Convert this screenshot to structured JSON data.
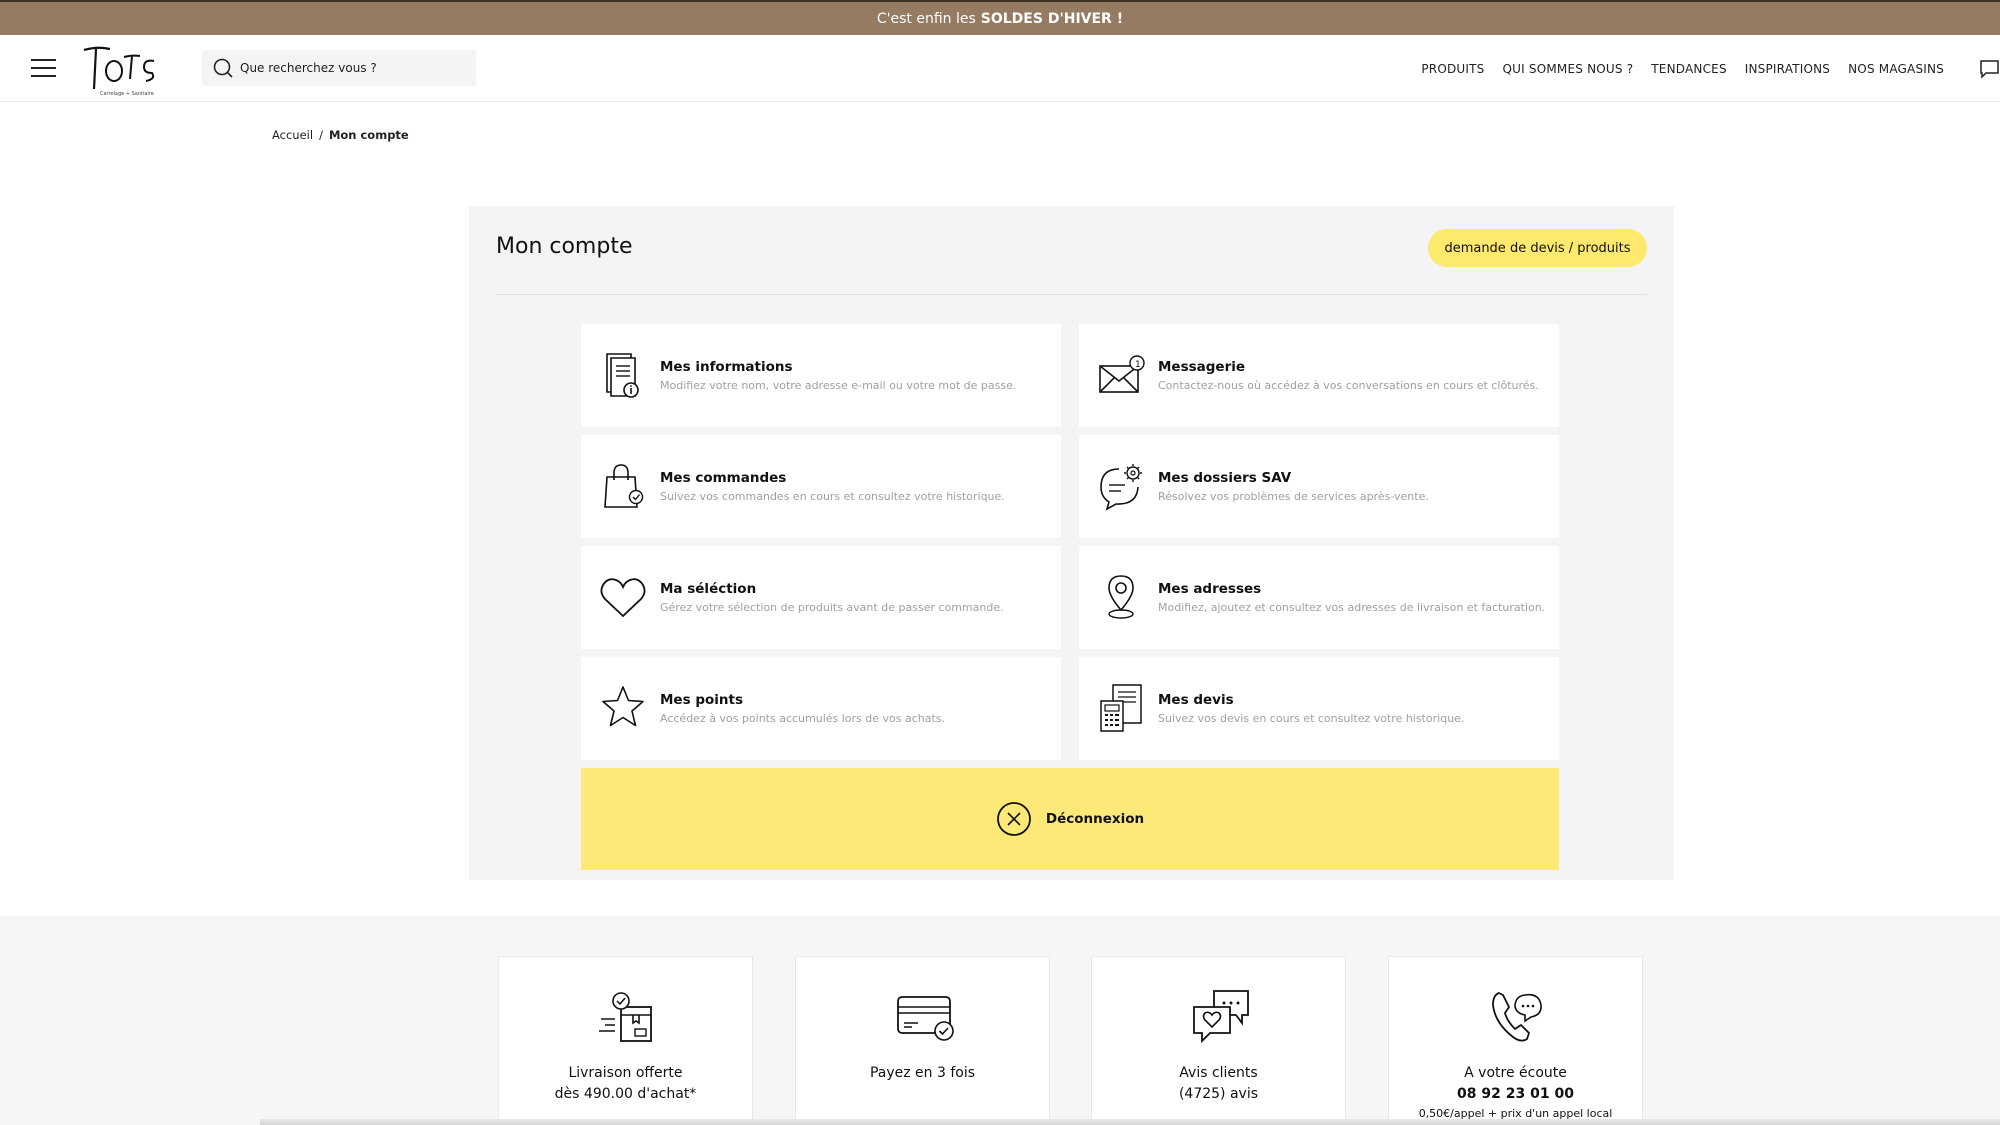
{
  "promo": {
    "prefix": "C'est enfin les",
    "highlight": "SOLDES D'HIVER !"
  },
  "header": {
    "logo_text": "Tots",
    "logo_tagline": "Carrelage + Sanitaire",
    "search_placeholder": "Que recherchez vous ?",
    "nav": [
      "PRODUITS",
      "QUI SOMMES NOUS ?",
      "TENDANCES",
      "INSPIRATIONS",
      "NOS MAGASINS"
    ]
  },
  "breadcrumb": {
    "home": "Accueil",
    "separator": "/",
    "current": "Mon compte"
  },
  "account": {
    "title": "Mon compte",
    "quote_button": "demande de devis / produits",
    "cards": [
      {
        "icon": "document-info-icon",
        "title": "Mes informations",
        "desc": "Modifiez votre nom, votre adresse e-mail ou votre mot de passe."
      },
      {
        "icon": "mail-notification-icon",
        "title": "Messagerie",
        "desc": "Contactez-nous où accédez à vos conversations en cours et clôturés."
      },
      {
        "icon": "shopping-bag-check-icon",
        "title": "Mes commandes",
        "desc": "Suivez vos commandes en cours et consultez votre historique."
      },
      {
        "icon": "support-gear-chat-icon",
        "title": "Mes dossiers SAV",
        "desc": "Résolvez vos problèmes de services après-vente."
      },
      {
        "icon": "heart-icon",
        "title": "Ma séléction",
        "desc": "Gérez votre sélection de produits avant de passer commande."
      },
      {
        "icon": "location-pin-icon",
        "title": "Mes adresses",
        "desc": "Modifiez, ajoutez et consultez vos adresses de livraison et facturation."
      },
      {
        "icon": "star-icon",
        "title": "Mes points",
        "desc": "Accédez à vos points accumulés lors de vos achats."
      },
      {
        "icon": "calculator-quote-icon",
        "title": "Mes devis",
        "desc": "Suivez vos devis en cours et consultez votre historique."
      }
    ],
    "logout": "Déconnexion"
  },
  "features": [
    {
      "icon": "delivery-box-icon",
      "line1": "Livraison offerte",
      "line2": "dès 490.00 d'achat*"
    },
    {
      "icon": "credit-card-icon",
      "line1": "Payez en 3 fois"
    },
    {
      "icon": "reviews-chat-icon",
      "line1": "Avis clients",
      "line2": "(4725) avis"
    },
    {
      "icon": "phone-chat-icon",
      "line1": "A votre écoute",
      "line2": "08 92 23 01 00",
      "line3": "0,50€/appel + prix d'un appel local"
    }
  ]
}
